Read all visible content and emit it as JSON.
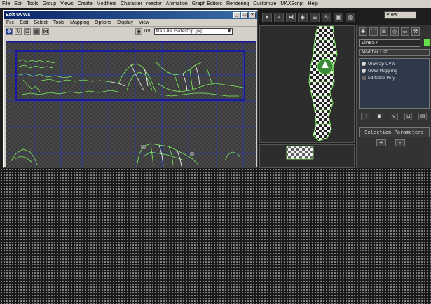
{
  "menubar": {
    "items": [
      "File",
      "Edit",
      "Tools",
      "Group",
      "Views",
      "Create",
      "Modifiers",
      "Character",
      "reactor",
      "Animation",
      "Graph Editors",
      "Rendering",
      "Customize",
      "MAXScript",
      "Help"
    ]
  },
  "uvw_window": {
    "title": "Edit UVWs",
    "menu": [
      "File",
      "Edit",
      "Select",
      "Tools",
      "Mapping",
      "Options",
      "Display",
      "View"
    ],
    "map_dropdown": "Map #9 (Sidestrip.jpg)",
    "uv_label": "UV"
  },
  "viewport_panel": {
    "view_dropdown": "View"
  },
  "command_panel": {
    "object_name": "Line57",
    "object_color": "#66e04a",
    "modifier_list_label": "Modifier List",
    "stack": [
      {
        "label": "Unwrap UVW"
      },
      {
        "label": "UVW Mapping"
      },
      {
        "label": "Editable Poly"
      }
    ],
    "rollout_title": "Selection Parameters",
    "plus_label": "+",
    "minus_label": "-"
  },
  "colors": {
    "uv_wire": "#7df05a",
    "uv_selected": "#ffffff",
    "grid_line": "#2a3aa0",
    "canvas_bg": "#3c3c3c"
  }
}
